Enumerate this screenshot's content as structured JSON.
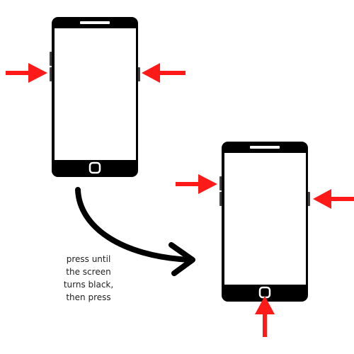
{
  "caption": {
    "lines": [
      "press until",
      "the screen",
      "turns black,",
      "then press"
    ]
  },
  "colors": {
    "arrow": "#ff1a1a",
    "phone": "#000000",
    "screen": "#ffffff",
    "side_button": "#444444"
  },
  "icons": [
    "phone-icon",
    "red-arrow-icon",
    "curved-arrow-icon",
    "home-button-icon"
  ]
}
